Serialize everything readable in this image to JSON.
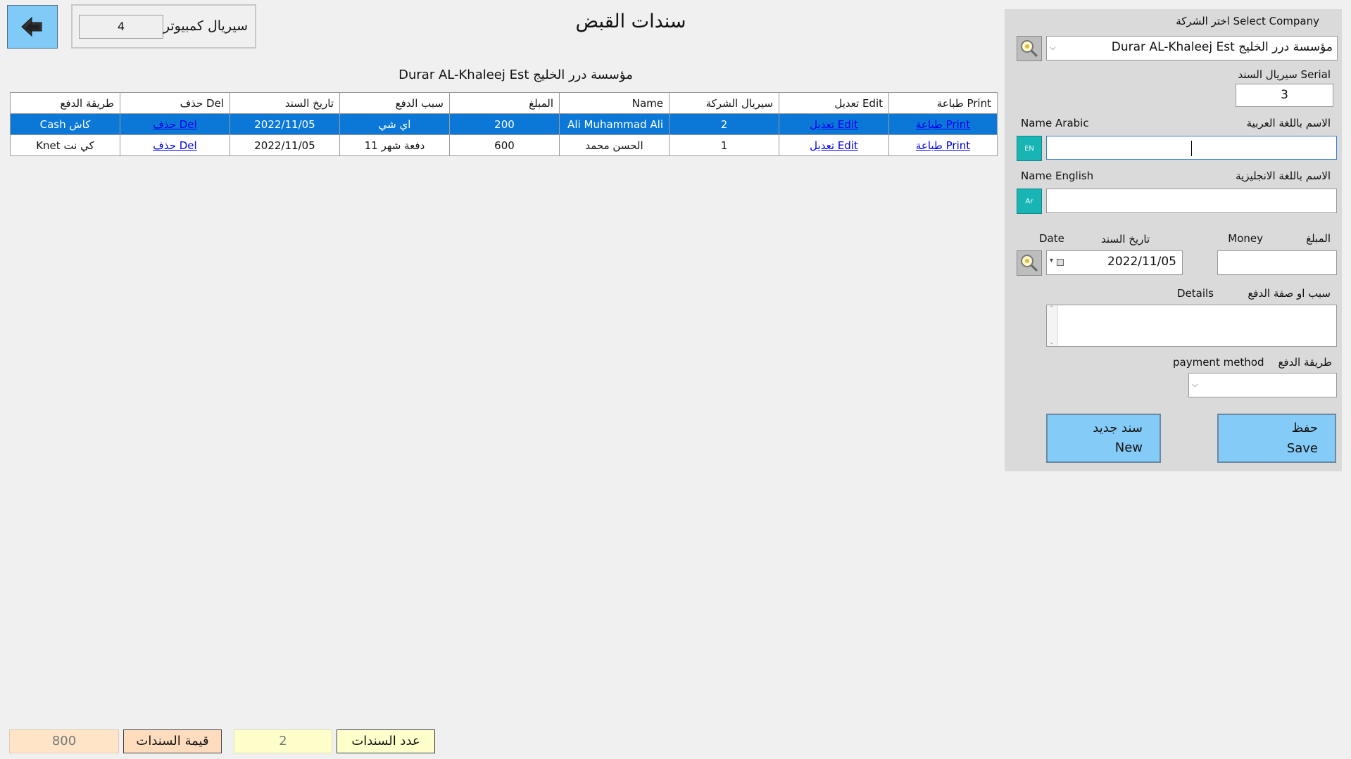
{
  "header": {
    "back_icon": "arrow-left-icon",
    "computer_serial_label": "سيريال كمبيوتر",
    "computer_serial_value": "4",
    "title": "سندات القبض",
    "company_heading": "Durar AL-Khaleej Est مؤسسة درر الخليج"
  },
  "table": {
    "columns": [
      "طباعة Print",
      "تعديل Edit",
      "سيريال الشركة",
      "Name",
      "المبلغ",
      "سبب الدفع",
      "تاريخ السند",
      "حذف Del",
      "طريقة الدفع"
    ],
    "rows": [
      {
        "print": "طباعة Print",
        "edit": "تعديل Edit",
        "company_serial": "2",
        "name": "Ali Muhammad Ali",
        "amount": "200",
        "reason": "اي شي",
        "date": "2022/11/05",
        "delete": "حذف Del",
        "payment": "Cash كاش",
        "selected": true
      },
      {
        "print": "طباعة Print",
        "edit": "تعديل Edit",
        "company_serial": "1",
        "name": "الحسن محمد",
        "amount": "600",
        "reason": "دفعة شهر 11",
        "date": "2022/11/05",
        "delete": "حذف Del",
        "payment": "Knet كي نت",
        "selected": false
      }
    ]
  },
  "form": {
    "select_company_label": "اختر الشركة Select Company",
    "company_value": "Durar AL-Khaleej Est مؤسسة درر الخليج",
    "serial_label": "سيريال السند Serial",
    "serial_value": "3",
    "name_arabic_label_en": "Name Arabic",
    "name_arabic_label_ar": "الاسم باللغة العربية",
    "name_arabic_value": "",
    "lang_en_button": "EN",
    "name_english_label_en": "Name English",
    "name_english_label_ar": "الاسم باللغة الانجليزية",
    "name_english_value": "",
    "lang_ar_button": "Ar",
    "date_label_en": "Date",
    "date_label_ar": "تاريخ السند",
    "date_value": "2022/11/05",
    "money_label_en": "Money",
    "money_label_ar": "المبلغ",
    "money_value": "",
    "details_label_en": "Details",
    "details_label_ar": "سبب او صفة الدفع",
    "details_value": "",
    "payment_label_en": "payment method",
    "payment_label_ar": "طريقة الدفع",
    "payment_value": "",
    "save_ar": "حفظ",
    "save_en": "Save",
    "new_ar": "سند جديد",
    "new_en": "New"
  },
  "footer": {
    "count_label": "عدد السندات",
    "count_value": "2",
    "total_label": "قيمة السندات",
    "total_value": "800"
  },
  "colors": {
    "accent_blue": "#85cbf7",
    "selected_row": "#0b78d7",
    "teal": "#19b4b4",
    "count_bg": "#ffffcc",
    "total_bg": "#ffe4c8"
  }
}
